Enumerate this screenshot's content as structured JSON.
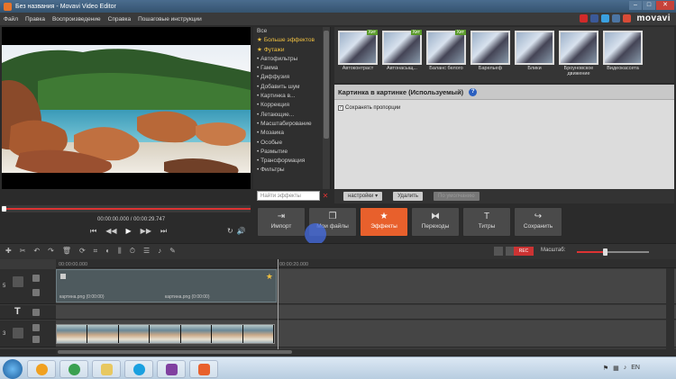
{
  "window": {
    "title": "Без названия - Movavi Video Editor"
  },
  "menu": [
    "Файл",
    "Правка",
    "Воспроизведение",
    "Справка",
    "Пошаговые инструкции"
  ],
  "brand": {
    "logo": "movavi",
    "social": [
      {
        "name": "youtube-icon",
        "color": "#d12a2a"
      },
      {
        "name": "facebook-icon",
        "color": "#3b5998"
      },
      {
        "name": "twitter-icon",
        "color": "#3aa0e0"
      },
      {
        "name": "vk-icon",
        "color": "#4c75a3"
      },
      {
        "name": "google-plus-icon",
        "color": "#d84b37"
      }
    ]
  },
  "effects_list": {
    "items": [
      {
        "label": "Все",
        "starred": false,
        "active": false
      },
      {
        "label": "Больше эффектов",
        "starred": true,
        "active": true
      },
      {
        "label": "Футажи",
        "starred": true,
        "active": true
      },
      {
        "label": "Автофильтры",
        "starred": false,
        "active": false
      },
      {
        "label": "Гамма",
        "starred": false,
        "active": false
      },
      {
        "label": "Диффузия",
        "starred": false,
        "active": false
      },
      {
        "label": "Добавить шум",
        "starred": false,
        "active": false
      },
      {
        "label": "Картинка в...",
        "starred": false,
        "active": false
      },
      {
        "label": "Коррекция",
        "starred": false,
        "active": false
      },
      {
        "label": "Летающие...",
        "starred": false,
        "active": false
      },
      {
        "label": "Масштабирование",
        "starred": false,
        "active": false
      },
      {
        "label": "Мозаика",
        "starred": false,
        "active": false
      },
      {
        "label": "Особые",
        "starred": false,
        "active": false
      },
      {
        "label": "Размытие",
        "starred": false,
        "active": false
      },
      {
        "label": "Трансформация",
        "starred": false,
        "active": false
      },
      {
        "label": "Фильтры",
        "starred": false,
        "active": false
      }
    ],
    "search_placeholder": "Найти эффекты"
  },
  "effect_thumbs": [
    {
      "label": "Автоконтраст",
      "badge": "Хит"
    },
    {
      "label": "Автонасыщ...",
      "badge": "Хит"
    },
    {
      "label": "Баланс белого",
      "badge": "Хит"
    },
    {
      "label": "Барельеф",
      "badge": ""
    },
    {
      "label": "Блики",
      "badge": ""
    },
    {
      "label": "Броуновское движение",
      "badge": ""
    },
    {
      "label": "Видеокассета",
      "badge": ""
    }
  ],
  "properties": {
    "title": "Картинка в картинке (Используемый)",
    "checkbox_label": "Сохранять пропорции",
    "buttons": {
      "settings": "настройки ▾",
      "delete": "Удалить",
      "default": "По умолчанию"
    }
  },
  "player": {
    "timecode": "00:00:00.000 / 00:00:29.747",
    "progress": 0.0
  },
  "main_buttons": [
    {
      "label": "Импорт",
      "icon": "import-icon",
      "active": false
    },
    {
      "label": "Мои файлы",
      "icon": "my-files-icon",
      "active": false
    },
    {
      "label": "Эффекты",
      "icon": "star-icon",
      "active": true
    },
    {
      "label": "Переходы",
      "icon": "transitions-icon",
      "active": false
    },
    {
      "label": "Титры",
      "icon": "titles-icon",
      "active": false
    },
    {
      "label": "Сохранить",
      "icon": "save-icon",
      "active": false
    }
  ],
  "toolbar": {
    "zoom_label": "Масштаб:",
    "zoom_level": 0.4
  },
  "timeline": {
    "ruler": [
      "00:00:00.000",
      "00:00:20.000"
    ],
    "clip_labels": [
      "картина.png (0:00:00)",
      "картина.png (0:00:00)"
    ],
    "tracks": [
      "5",
      "T",
      "3"
    ]
  },
  "taskbar": {
    "time": "",
    "apps": [
      {
        "name": "ie-icon",
        "color": "#f0a020"
      },
      {
        "name": "chrome-icon",
        "color": "#3aa050"
      },
      {
        "name": "folder-icon",
        "color": "#e8c860"
      },
      {
        "name": "skype-icon",
        "color": "#1aa0e0"
      },
      {
        "name": "media-icon",
        "color": "#8040a0"
      },
      {
        "name": "movavi-icon",
        "color": "#e8602c"
      }
    ]
  }
}
